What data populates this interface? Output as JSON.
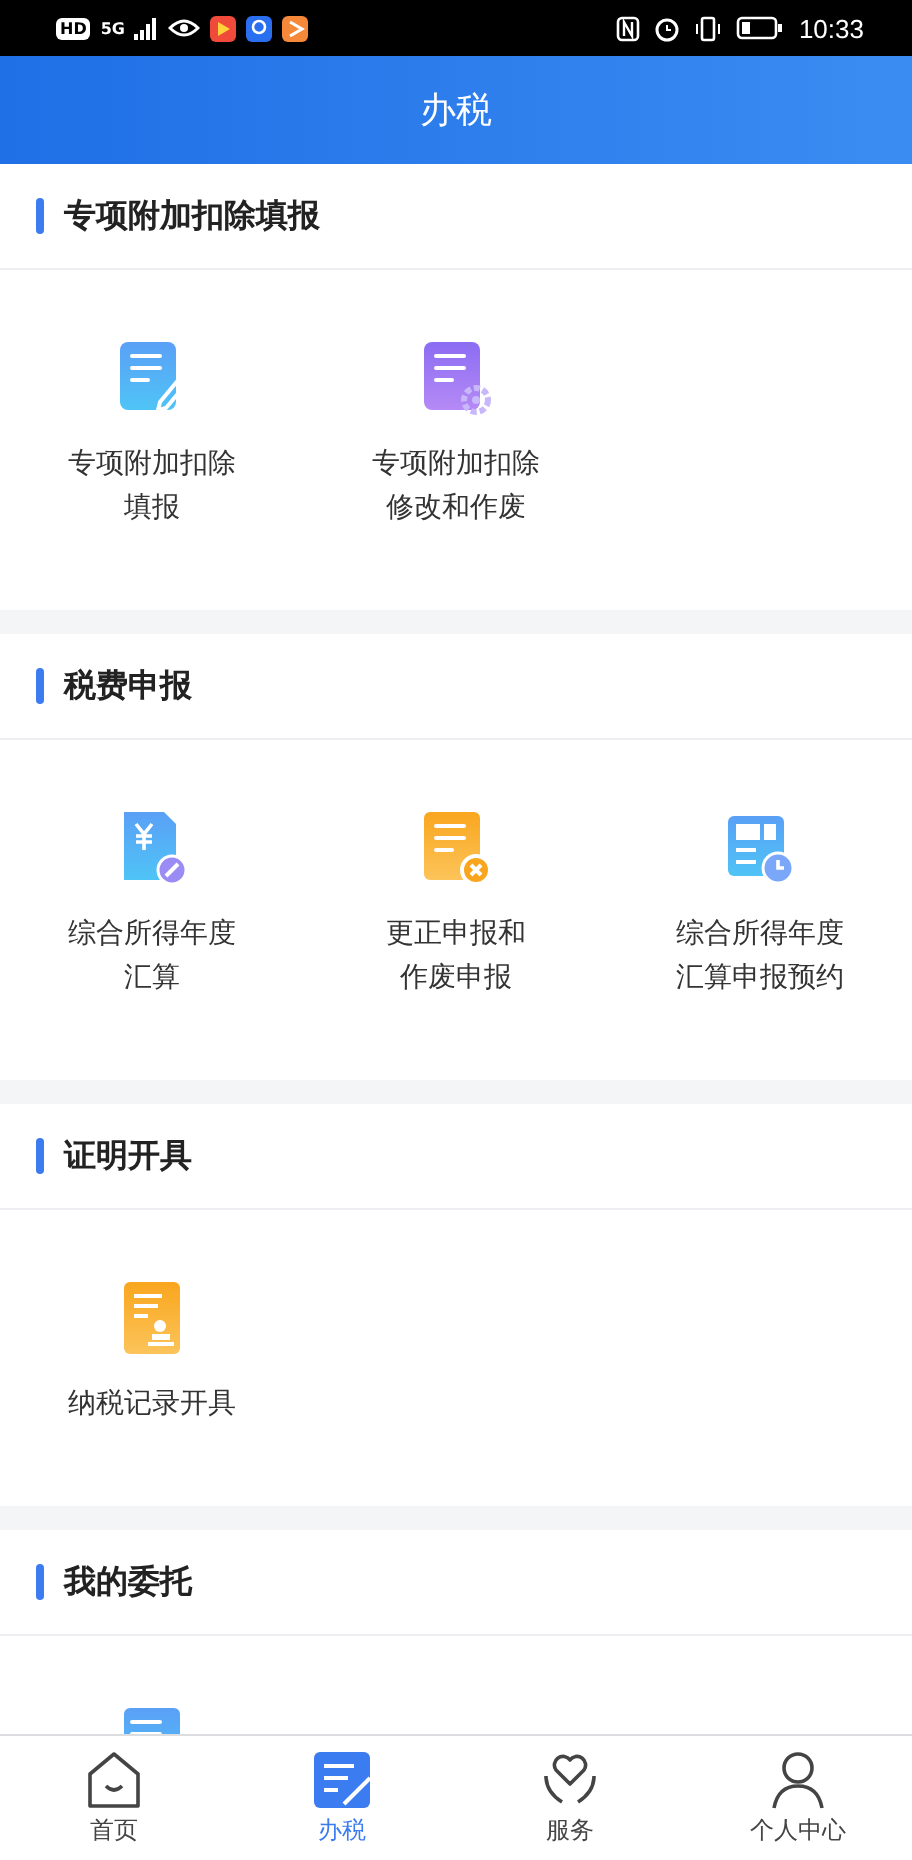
{
  "status_bar": {
    "badges": [
      "HD",
      "5G"
    ],
    "time": "10:33"
  },
  "header": {
    "title": "办税"
  },
  "sections": [
    {
      "title": "专项附加扣除填报",
      "items": [
        {
          "kind": "doc-pen",
          "label": [
            "专项附加扣除",
            "填报"
          ]
        },
        {
          "kind": "doc-gear",
          "label": [
            "专项附加扣除",
            "修改和作废"
          ]
        }
      ]
    },
    {
      "title": "税费申报",
      "items": [
        {
          "kind": "yen-doc",
          "label": [
            "综合所得年度",
            "汇算"
          ]
        },
        {
          "kind": "doc-x",
          "label": [
            "更正申报和",
            "作废申报"
          ]
        },
        {
          "kind": "calendar-clock",
          "label": [
            "综合所得年度",
            "汇算申报预约"
          ]
        }
      ]
    },
    {
      "title": "证明开具",
      "items": [
        {
          "kind": "doc-stamp",
          "label": [
            "纳税记录开具"
          ]
        }
      ]
    },
    {
      "title": "我的委托",
      "items": [
        {
          "kind": "doc"
        }
      ]
    }
  ],
  "nav": [
    {
      "kind": "home",
      "label": "首页",
      "selected": false
    },
    {
      "kind": "tax",
      "label": "办税",
      "selected": true
    },
    {
      "kind": "heart",
      "label": "服务",
      "selected": false
    },
    {
      "kind": "person",
      "label": "个人中心",
      "selected": false
    }
  ]
}
